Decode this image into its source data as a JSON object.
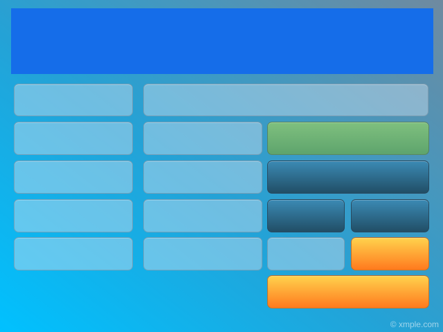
{
  "colors": {
    "display": "#156de9",
    "key_light": "#a8cde2",
    "key_green": "#6eb277",
    "key_dark": "#2b6a8b",
    "key_orange": "#ff9a30",
    "background_bottom": "#00c1ff",
    "background_top": "#6f8aa0"
  },
  "watermark": {
    "text": "© xmple.com"
  }
}
